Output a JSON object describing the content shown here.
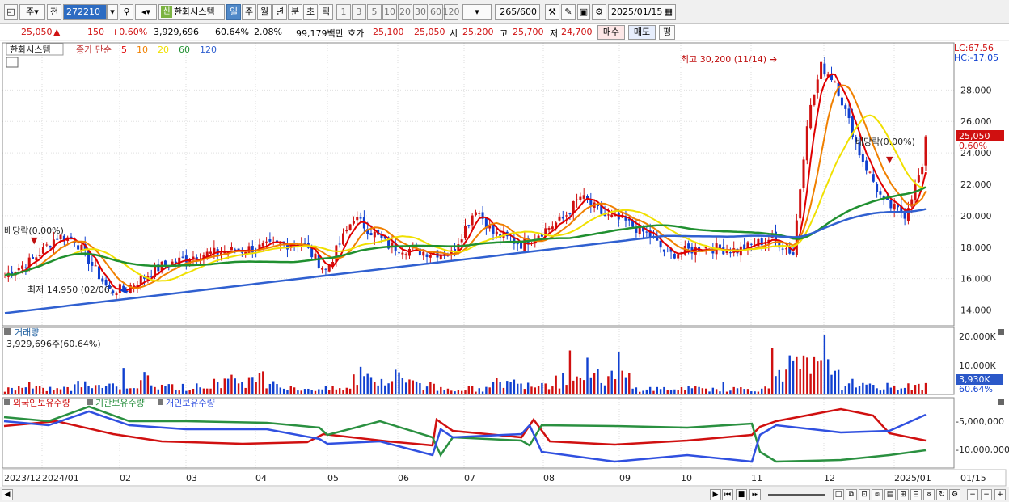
{
  "toolbar": {
    "mode": "주",
    "prev": "전",
    "code": "272210",
    "company": "한화시스템",
    "company_badge": "신",
    "periods": [
      "일",
      "주",
      "월",
      "년",
      "분",
      "초",
      "틱"
    ],
    "intervals": [
      "1",
      "3",
      "5",
      "10",
      "20",
      "30",
      "60",
      "120"
    ],
    "count": "265",
    "count_max": "/600",
    "date": "2025/01/15"
  },
  "quote": {
    "price": "25,050",
    "change": "150",
    "change_pct": "+0.60%",
    "volume": "3,929,696",
    "vol_ratio": "60.64%",
    "turnover": "2.08%",
    "amount": "99,179백만",
    "bid_label": "호가",
    "bid1": "25,100",
    "bid2": "25,050",
    "open_label": "시",
    "open": "25,200",
    "high_label": "고",
    "high": "25,700",
    "low_label": "저",
    "low": "24,700",
    "buy": "매수",
    "sell": "매도",
    "avg": "평"
  },
  "price_panel": {
    "name": "한화시스템",
    "ma_label": "종가 단순",
    "ma": [
      "5",
      "10",
      "20",
      "60",
      "120"
    ],
    "lc": "LC:67.56",
    "hc": "HC:-17.05",
    "y_ticks": [
      "28,000",
      "26,000",
      "24,000",
      "22,000",
      "20,000",
      "18,000",
      "16,000",
      "14,000"
    ],
    "current_price": "25,050",
    "current_pct": "0.60%",
    "high_note": "최고 30,200 (11/14)",
    "low_note": "최저 14,950 (02/06)",
    "div1": "배당락(0.00%)",
    "div2": "배당락(0.00%)"
  },
  "volume_panel": {
    "title": "거래량",
    "value": "3,929,696주(60.64%)",
    "y_ticks": [
      "20,000K",
      "10,000K"
    ],
    "current": "3,930K",
    "current_pct": "60.64%"
  },
  "holdings_panel": {
    "foreign": "외국인보유수량",
    "institution": "기관보유수량",
    "individual": "개인보유수량",
    "y_ticks": [
      "-5,000,000",
      "-10,000,000"
    ]
  },
  "x_axis": {
    "labels": [
      "2023/12",
      "2024/01",
      "02",
      "03",
      "04",
      "05",
      "06",
      "07",
      "08",
      "09",
      "10",
      "11",
      "12",
      "2025/01",
      "01/15"
    ]
  },
  "colors": {
    "up": "#d01010",
    "down": "#1040d0",
    "ma5": "#e00000",
    "ma10": "#f08000",
    "ma20": "#f0e000",
    "ma60": "#209030",
    "ma120": "#3060d0"
  },
  "chart_data": {
    "type": "line",
    "title": "한화시스템",
    "x": [
      "2023/12",
      "2024/01",
      "02",
      "03",
      "04",
      "05",
      "06",
      "07",
      "08",
      "09",
      "10",
      "11",
      "12",
      "2025/01"
    ],
    "close_approx": [
      16200,
      18600,
      15200,
      17200,
      17800,
      19800,
      17800,
      19000,
      19800,
      18000,
      18000,
      28800,
      20500,
      25050
    ],
    "volume_k": [
      3000,
      5000,
      4000,
      7000,
      3000,
      8000,
      3000,
      6000,
      9000,
      3000,
      3000,
      14000,
      4000,
      3930
    ],
    "ylim": [
      13000,
      31000
    ],
    "y_unit": "KRW",
    "high": 30200,
    "low": 14950
  }
}
